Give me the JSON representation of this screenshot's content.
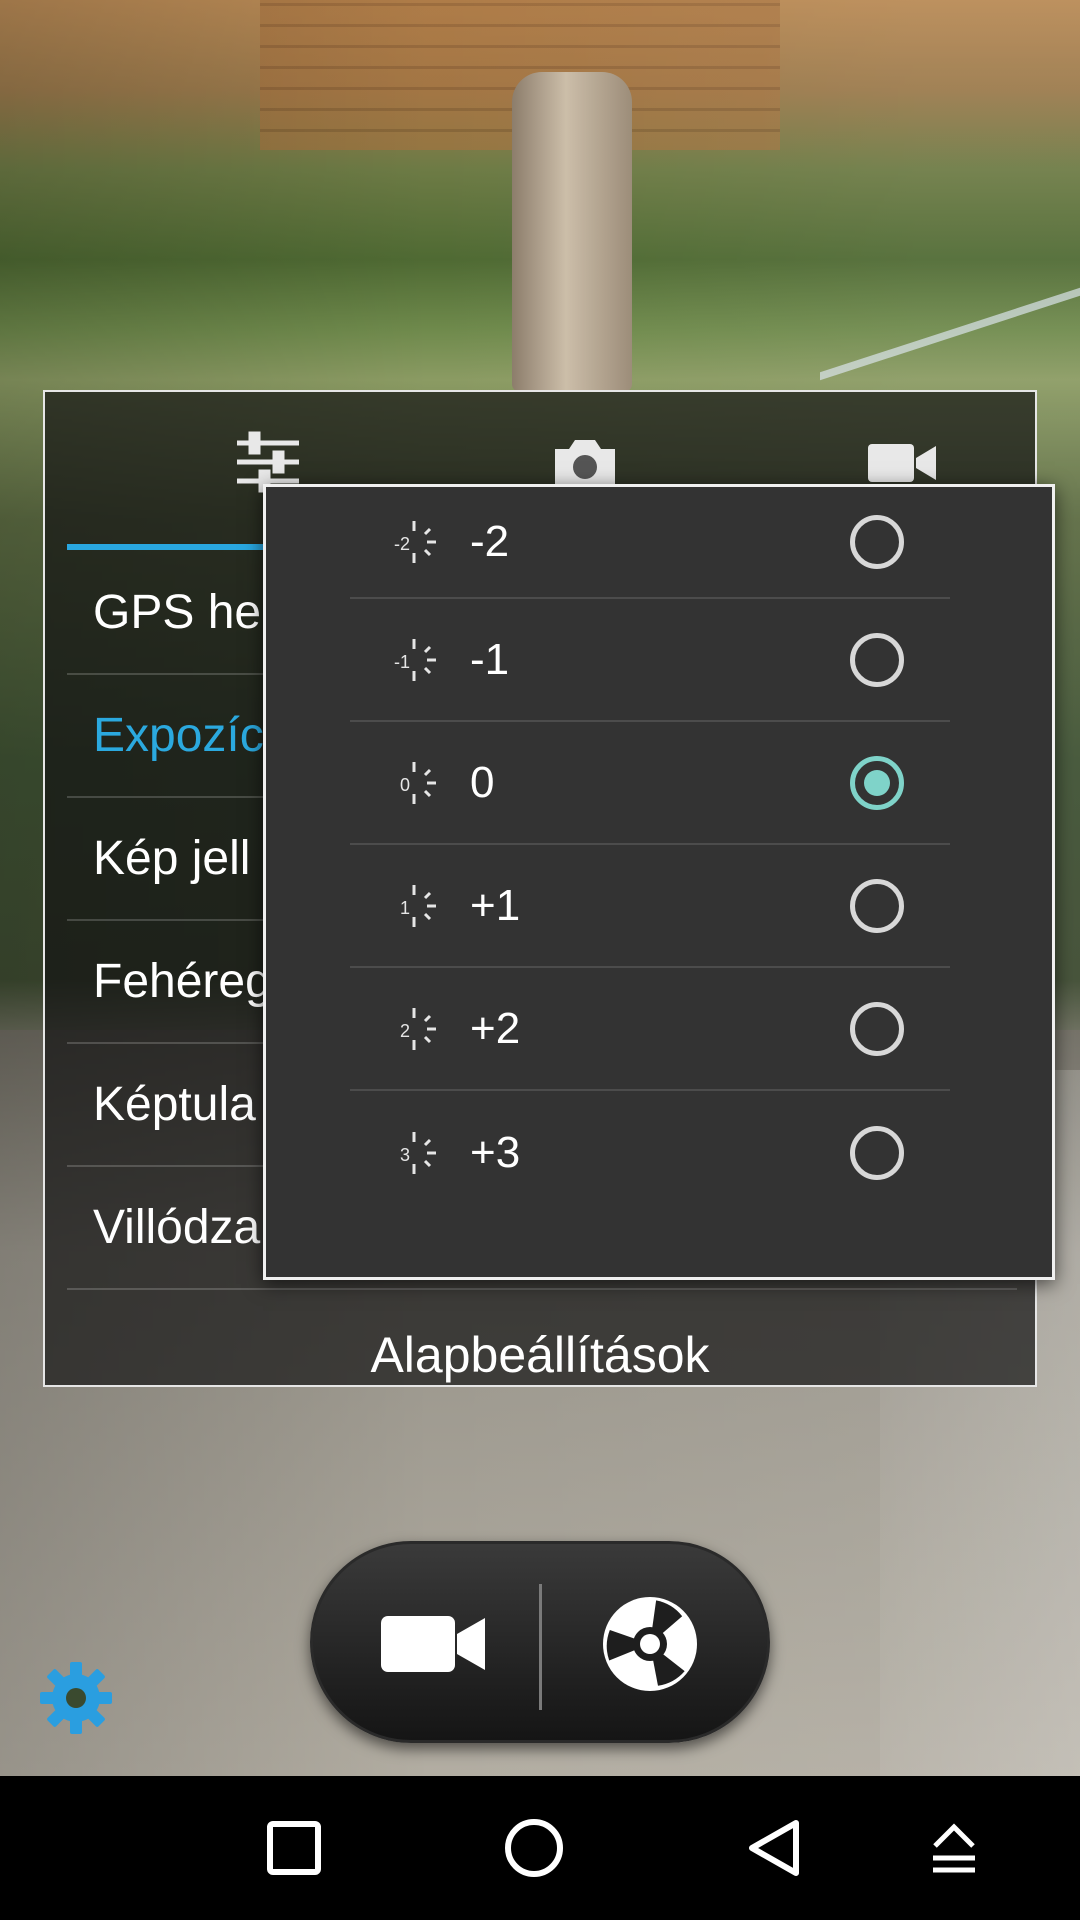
{
  "settings_panel": {
    "tabs": [
      {
        "icon": "sliders-icon"
      },
      {
        "icon": "camera-icon"
      },
      {
        "icon": "video-camera-icon"
      }
    ],
    "items": [
      {
        "label": "GPS he"
      },
      {
        "label": "Expozíc"
      },
      {
        "label": "Kép jell"
      },
      {
        "label": "Fehéreg"
      },
      {
        "label": "Képtula"
      },
      {
        "label": "Villódza"
      }
    ],
    "active_color": "#2ba9df",
    "footer_label": "Alapbeállítások"
  },
  "exposure_dialog": {
    "options": [
      {
        "icon_value": "-2",
        "label": "-2",
        "selected": false
      },
      {
        "icon_value": "-1",
        "label": "-1",
        "selected": false
      },
      {
        "icon_value": "0",
        "label": "0",
        "selected": true
      },
      {
        "icon_value": "1",
        "label": "+1",
        "selected": false
      },
      {
        "icon_value": "2",
        "label": "+2",
        "selected": false
      },
      {
        "icon_value": "3",
        "label": "+3",
        "selected": false
      }
    ],
    "radio_checked_color": "#7fd3c9"
  },
  "controls": {
    "video_icon": "video-record-icon",
    "shutter_icon": "shutter-aperture-icon",
    "settings_icon": "gear-icon",
    "settings_color": "#2a9ee0"
  },
  "navbar": {
    "buttons": [
      "recents-icon",
      "home-icon",
      "back-icon",
      "upload-icon"
    ]
  }
}
